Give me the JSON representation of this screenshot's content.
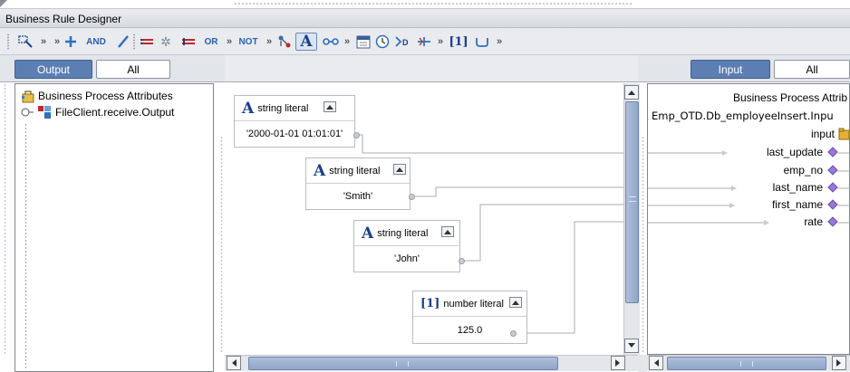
{
  "window": {
    "title": "Business Rule Designer"
  },
  "toolbar": {
    "and_label": "AND",
    "or_label": "OR",
    "not_label": "NOT",
    "number_label": "[1]"
  },
  "left_tabs": {
    "output_label": "Output",
    "all_label": "All"
  },
  "right_tabs": {
    "input_label": "Input",
    "all_label": "All"
  },
  "left_tree": {
    "root_label": "Business Process Attributes",
    "child_label": "FileClient.receive.Output"
  },
  "literals": [
    {
      "type_label": "string literal",
      "value": "'2000-01-01 01:01:01'"
    },
    {
      "type_label": "string literal",
      "value": "'Smith'"
    },
    {
      "type_label": "string literal",
      "value": "'John'"
    },
    {
      "type_label": "number literal",
      "value": "125.0"
    }
  ],
  "right_tree": {
    "root_label": "Business Process Attrib",
    "object_label": "Emp_OTD.Db_employeeInsert.Inpu",
    "input_label": "input",
    "fields": [
      "last_update",
      "emp_no",
      "last_name",
      "first_name",
      "rate"
    ]
  },
  "colors": {
    "accent": "#5c7eb3",
    "link_line": "#a9adb3",
    "field_diamond": "#9a78d8"
  }
}
